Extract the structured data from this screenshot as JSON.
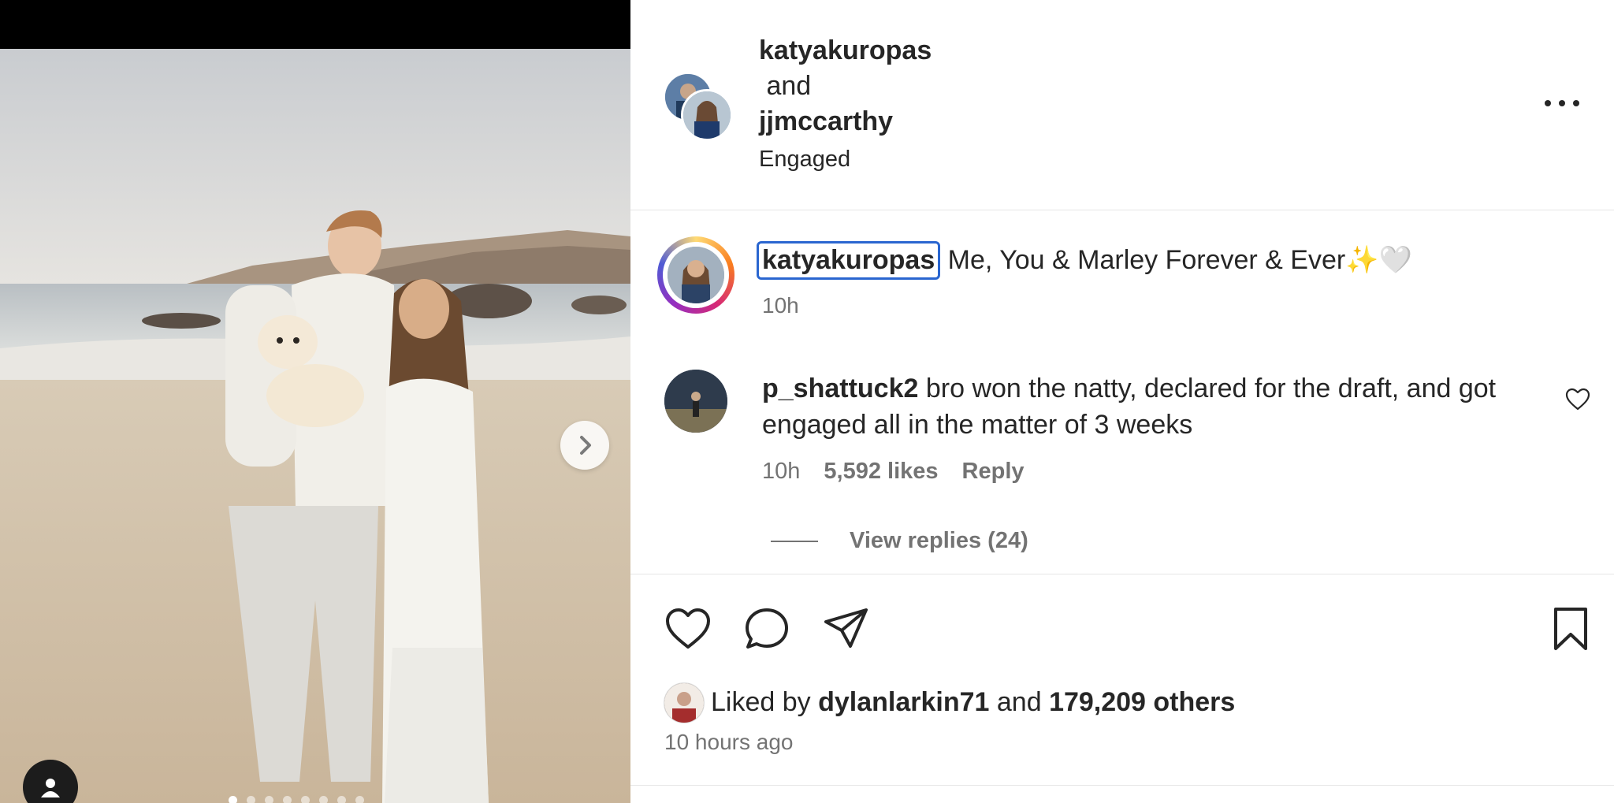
{
  "post": {
    "header": {
      "user1": "katyakuropas",
      "and_text": " and",
      "user2": "jjmccarthy",
      "location": "Engaged"
    },
    "caption": {
      "username": "katyakuropas",
      "text": " Me, You & Marley Forever & Ever✨🤍",
      "time": "10h"
    },
    "comment": {
      "username": "p_shattuck2",
      "text": " bro won the natty, declared for the draft, and got engaged all in the matter of 3 weeks",
      "time": "10h",
      "likes": "5,592 likes",
      "reply_label": "Reply",
      "view_replies": "View replies (24)"
    },
    "likes": {
      "prefix": "Liked by ",
      "user": "dylanlarkin71",
      "middle": " and ",
      "others": "179,209 others"
    },
    "time_ago": "10 hours ago"
  },
  "icons": {
    "next": "chevron-right-icon",
    "tagged": "user-icon",
    "more": "more-icon",
    "like": "heart-icon",
    "comment": "speech-bubble-icon",
    "share": "paper-plane-icon",
    "save": "bookmark-icon"
  },
  "colors": {
    "text": "#262626",
    "secondary": "#737373",
    "focus_outline": "#2a66d0",
    "divider": "#e6e6e6"
  }
}
